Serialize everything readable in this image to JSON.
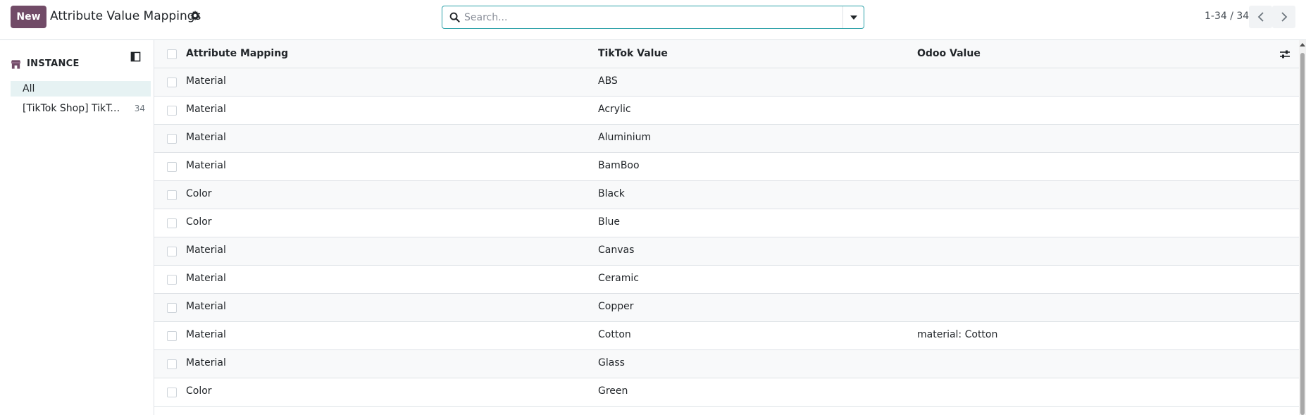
{
  "toolbar": {
    "new_label": "New",
    "title": "Attribute Value Mappings",
    "search_placeholder": "Search...",
    "pager_value": "1-34 / 34"
  },
  "sidebar": {
    "heading": "INSTANCE",
    "items": [
      {
        "label": "All",
        "count": ""
      },
      {
        "label": "[TikTok Shop] TikTok ...",
        "count": "34"
      }
    ]
  },
  "table": {
    "columns": [
      "Attribute Mapping",
      "TikTok Value",
      "Odoo Value"
    ],
    "rows": [
      {
        "attribute": "Material",
        "tiktok": "ABS",
        "odoo": ""
      },
      {
        "attribute": "Material",
        "tiktok": "Acrylic",
        "odoo": ""
      },
      {
        "attribute": "Material",
        "tiktok": "Aluminium",
        "odoo": ""
      },
      {
        "attribute": "Material",
        "tiktok": "BamBoo",
        "odoo": ""
      },
      {
        "attribute": "Color",
        "tiktok": "Black",
        "odoo": ""
      },
      {
        "attribute": "Color",
        "tiktok": "Blue",
        "odoo": ""
      },
      {
        "attribute": "Material",
        "tiktok": "Canvas",
        "odoo": ""
      },
      {
        "attribute": "Material",
        "tiktok": "Ceramic",
        "odoo": ""
      },
      {
        "attribute": "Material",
        "tiktok": "Copper",
        "odoo": ""
      },
      {
        "attribute": "Material",
        "tiktok": "Cotton",
        "odoo": "material: Cotton"
      },
      {
        "attribute": "Material",
        "tiktok": "Glass",
        "odoo": ""
      },
      {
        "attribute": "Color",
        "tiktok": "Green",
        "odoo": ""
      }
    ]
  },
  "icons": {
    "settings": "gear-icon",
    "search": "search-icon",
    "dropdown": "caret-down-icon",
    "prev": "chevron-left-icon",
    "next": "chevron-right-icon",
    "instance": "shop-icon",
    "sidebar_toggle": "panel-toggle-icon",
    "optional_columns": "sliders-icon"
  },
  "colors": {
    "brand": "#714b67",
    "search_border": "#2aa0a8",
    "active_filter": "#e6f2f3"
  }
}
